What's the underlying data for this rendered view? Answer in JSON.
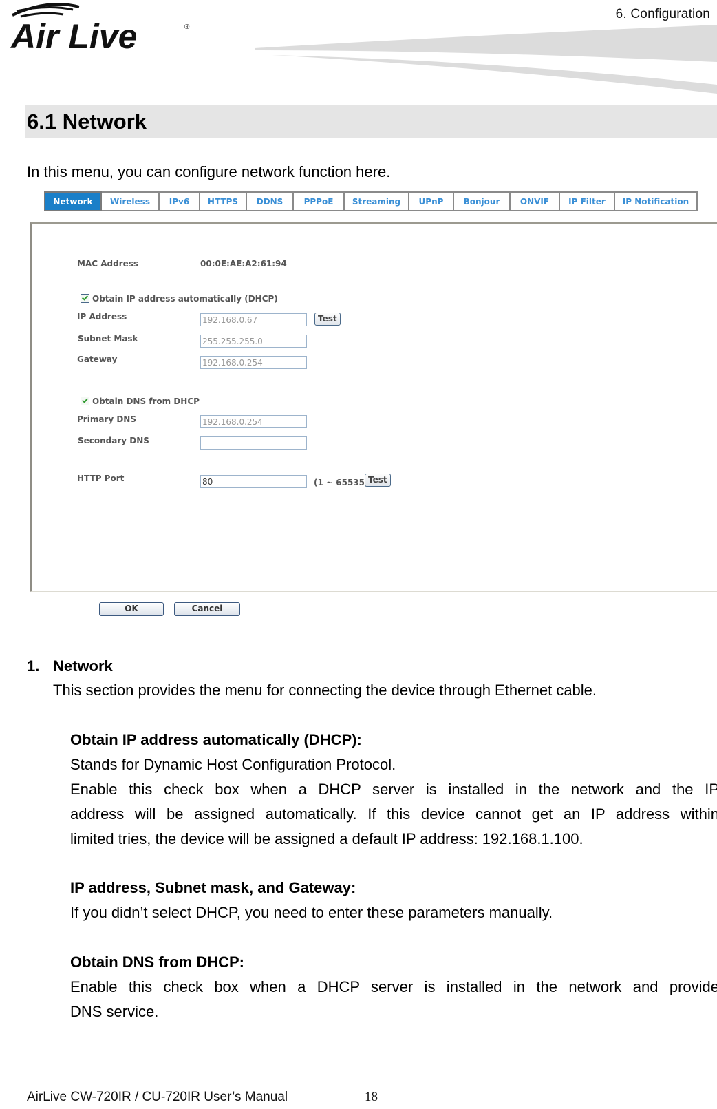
{
  "header": {
    "brand": "Air Live",
    "chapter": "6.  Configuration"
  },
  "section": {
    "title": "6.1 Network",
    "intro": "In this menu, you can configure network function here."
  },
  "screenshot": {
    "tabs": [
      {
        "label": "Network",
        "active": true
      },
      {
        "label": "Wireless",
        "active": false
      },
      {
        "label": "IPv6",
        "active": false
      },
      {
        "label": "HTTPS",
        "active": false
      },
      {
        "label": "DDNS",
        "active": false
      },
      {
        "label": "PPPoE",
        "active": false
      },
      {
        "label": "Streaming",
        "active": false
      },
      {
        "label": "UPnP",
        "active": false
      },
      {
        "label": "Bonjour",
        "active": false
      },
      {
        "label": "ONVIF",
        "active": false
      },
      {
        "label": "IP Filter",
        "active": false
      },
      {
        "label": "IP Notification",
        "active": false
      }
    ],
    "mac_label": "MAC Address",
    "mac_value": "00:0E:AE:A2:61:94",
    "dhcp_checkbox": {
      "label": "Obtain IP address automatically (DHCP)",
      "checked": true
    },
    "ip_label": "IP Address",
    "ip_value": "192.168.0.67",
    "subnet_label": "Subnet Mask",
    "subnet_value": "255.255.255.0",
    "gateway_label": "Gateway",
    "gateway_value": "192.168.0.254",
    "dns_checkbox": {
      "label": "Obtain DNS from DHCP",
      "checked": true
    },
    "primary_dns_label": "Primary DNS",
    "primary_dns_value": "192.168.0.254",
    "secondary_dns_label": "Secondary DNS",
    "secondary_dns_value": "",
    "http_port_label": "HTTP Port",
    "http_port_value": "80",
    "http_port_range": "(1 ~ 65535)",
    "test_label": "Test",
    "ok_label": "OK",
    "cancel_label": "Cancel"
  },
  "body": {
    "item_number": "1.",
    "item_title": "Network",
    "item_desc": "This section provides the menu for connecting the device through Ethernet cable.",
    "dhcp_heading": "Obtain IP address automatically (DHCP):",
    "dhcp_line1": "Stands for Dynamic Host Configuration Protocol.",
    "dhcp_line2": "Enable this check box when a DHCP server is installed in the network and the IP",
    "dhcp_line3": "address will be assigned automatically. If this device cannot get an IP address within",
    "dhcp_line4": "limited tries, the device will be assigned a default IP address: 192.168.1.100.",
    "ip_heading": "IP address, Subnet mask, and Gateway:",
    "ip_line1": "If you didn’t select DHCP, you need to enter these parameters manually.",
    "dns_heading": "Obtain DNS from DHCP:",
    "dns_line1": "Enable this check box when a DHCP server is installed in the network and provide",
    "dns_line2": "DNS service."
  },
  "footer": {
    "manual": "AirLive CW-720IR / CU-720IR User’s Manual",
    "page": "18"
  }
}
